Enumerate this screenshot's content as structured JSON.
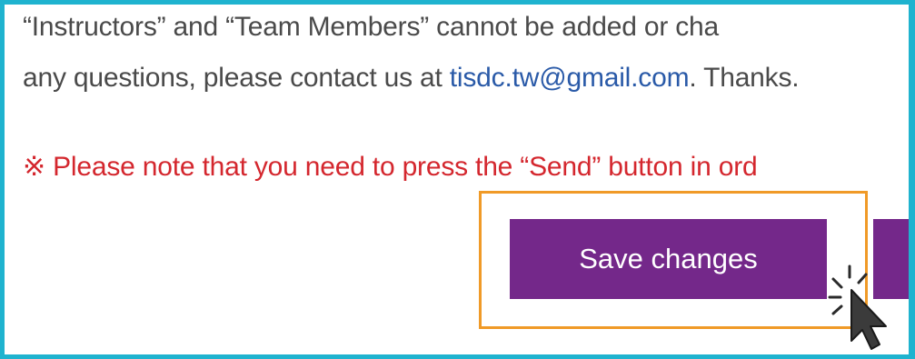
{
  "notice": {
    "line1": "“Instructors” and “Team Members” cannot be added or cha",
    "line2_prefix": "any questions, please contact us at ",
    "email": "tisdc.tw@gmail.com",
    "line2_suffix": ". Thanks.",
    "warning": "※ Please note that you need to press the “Send” button in ord"
  },
  "actions": {
    "save_label": "Save changes"
  },
  "colors": {
    "frame": "#1fb3cf",
    "highlight": "#f09a27",
    "button": "#74288a",
    "warning_text": "#d4272e",
    "link": "#2a5aa8"
  },
  "icons": {
    "cursor": "mouse-pointer-click-icon"
  }
}
